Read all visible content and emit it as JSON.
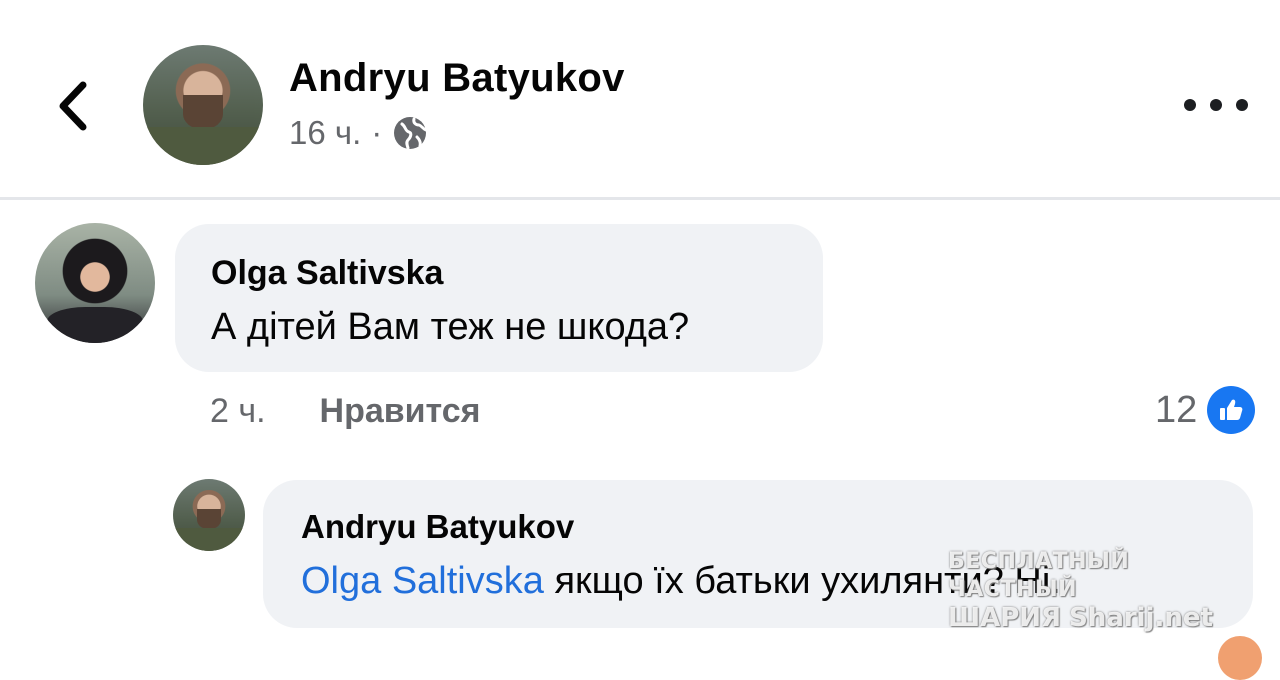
{
  "post": {
    "author": "Andryu Batyukov",
    "time": "16 ч.",
    "separator": "·",
    "privacy_icon": "globe-icon",
    "back_icon": "chevron-left-icon",
    "more_icon": "more-horizontal-icon"
  },
  "comment": {
    "author": "Olga Saltivska",
    "text": "А дітей Вам теж не шкода?",
    "time": "2 ч.",
    "like_label": "Нравится",
    "reaction_count": "12",
    "reaction_icon": "thumbs-up-icon",
    "reaction_color": "#1877f2"
  },
  "reply": {
    "author": "Andryu Batyukov",
    "mention": "Olga Saltivska",
    "text": " якщо їх батьки ухилянти? Ні."
  },
  "watermark": {
    "line1": "БЕСПЛАТНЫЙ ЧАСТНЫЙ",
    "line2a": "ШАРИЯ",
    "line2b": "Sharij.net"
  },
  "colors": {
    "bubble": "#f0f2f5",
    "secondary_text": "#65676b",
    "mention": "#216fdb",
    "divider": "#e4e6ea"
  }
}
